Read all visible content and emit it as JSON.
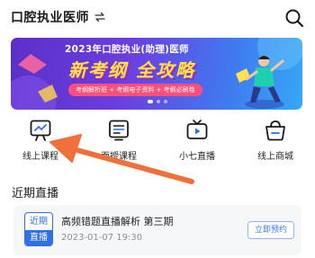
{
  "header": {
    "title": "口腔执业医师",
    "switch_icon": "swap-arrows-icon",
    "search_icon": "search-icon"
  },
  "banner": {
    "headline": "2023年口腔执业(助理)医师",
    "main_text": "新考纲 全攻略",
    "pill_text": "考纲解析班 + 考纲电子资料 + 考纲必刷卷",
    "page_count": 3,
    "active_page": 1
  },
  "nav_grid": [
    {
      "label": "线上课程",
      "icon": "presentation-board-icon"
    },
    {
      "label": "面授课程",
      "icon": "document-board-icon"
    },
    {
      "label": "小七直播",
      "icon": "tv-play-icon"
    },
    {
      "label": "线上商城",
      "icon": "shopping-basket-icon"
    }
  ],
  "recent_live": {
    "section_title": "近期直播",
    "badge_top": "近期",
    "badge_bottom": "直播",
    "title": "高频错题直播解析 第三期",
    "time": "2023-01-07 19:30",
    "button_label": "立即预约"
  },
  "colors": {
    "accent_blue": "#2f6fe8",
    "arrow_orange": "#f0703c",
    "banner_yellow": "#ffe34a"
  }
}
